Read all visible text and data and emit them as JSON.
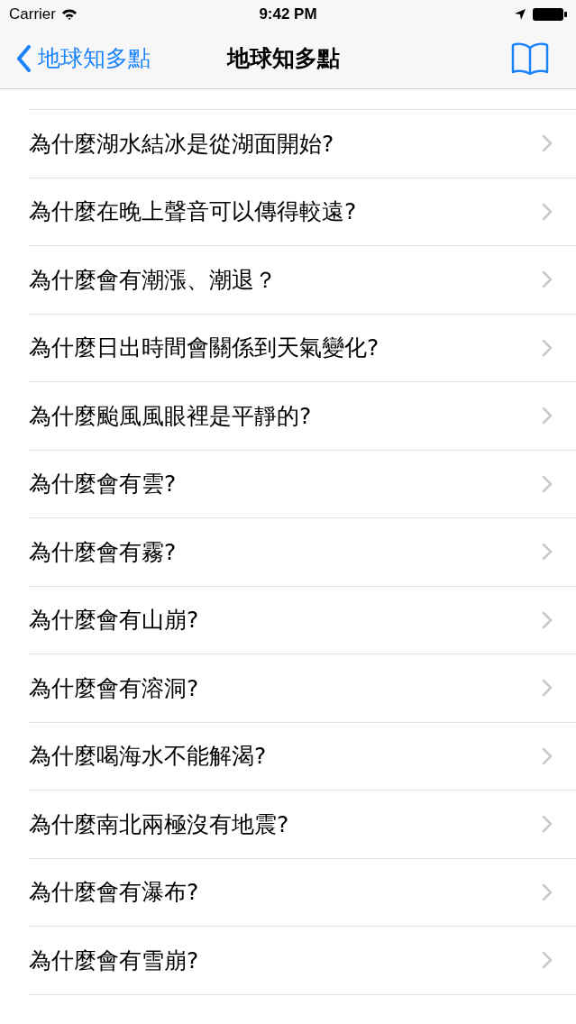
{
  "status_bar": {
    "carrier": "Carrier",
    "time": "9:42 PM"
  },
  "nav_bar": {
    "back_label": "地球知多點",
    "title": "地球知多點"
  },
  "list": {
    "items": [
      {
        "label": "為什麼湖水結冰是從湖面開始?"
      },
      {
        "label": "為什麼在晚上聲音可以傳得較遠?"
      },
      {
        "label": "為什麼會有潮漲、潮退？"
      },
      {
        "label": "為什麼日出時間會關係到天氣變化?"
      },
      {
        "label": "為什麼颱風風眼裡是平靜的?"
      },
      {
        "label": "為什麼會有雲?"
      },
      {
        "label": "為什麼會有霧?"
      },
      {
        "label": "為什麼會有山崩?"
      },
      {
        "label": "為什麼會有溶洞?"
      },
      {
        "label": "為什麼喝海水不能解渴?"
      },
      {
        "label": "為什麼南北兩極沒有地震?"
      },
      {
        "label": "為什麼會有瀑布?"
      },
      {
        "label": "為什麼會有雪崩?"
      }
    ]
  }
}
